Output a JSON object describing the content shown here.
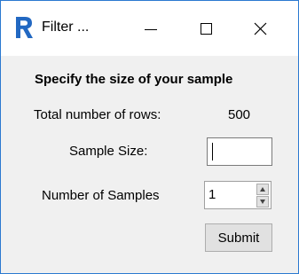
{
  "window": {
    "title": "Filter ...",
    "app_icon": "r-logo-icon",
    "controls": {
      "minimize_icon": "minimize-icon",
      "maximize_icon": "maximize-icon",
      "close_icon": "close-icon"
    },
    "border_color": "#2b79d0"
  },
  "form": {
    "heading": "Specify the size of your sample",
    "total_rows_label": "Total number of rows:",
    "total_rows_value": "500",
    "sample_size_label": "Sample Size:",
    "sample_size_value": "",
    "num_samples_label": "Number of Samples",
    "num_samples_value": "1",
    "submit_label": "Submit"
  }
}
